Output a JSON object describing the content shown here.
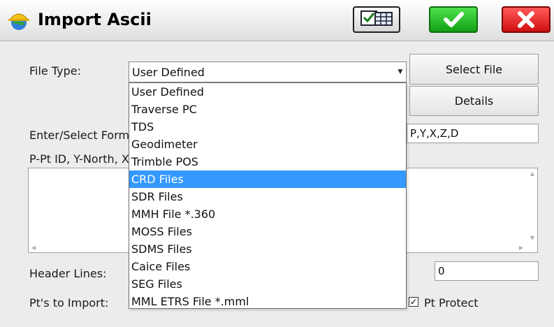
{
  "window": {
    "title": "Import Ascii",
    "icon": "hardhat-globe-icon",
    "buttons": [
      {
        "name": "view-table-button",
        "icon": "checklist-table-icon"
      },
      {
        "name": "ok-button",
        "icon": "checkmark-icon",
        "color": "#22c022"
      },
      {
        "name": "cancel-button",
        "icon": "close-x-icon",
        "color": "#e01818"
      }
    ]
  },
  "form": {
    "file_type_label": "File Type:",
    "file_type_value": "User Defined",
    "select_file_label": "Select File",
    "details_label": "Details",
    "format_label": "Enter/Select Format:",
    "format_value": "P,Y,X,Z,D",
    "legend_label": "P-Pt ID, Y-North, X-East, Z-Elev, D-Desc",
    "header_lines_label": "Header Lines:",
    "header_lines_value": "0",
    "pts_to_import_label": "Pt's to Import:",
    "pt_protect_label": "Pt Protect",
    "pt_protect_checked": true,
    "checkmark_glyph": "✓"
  },
  "dropdown": {
    "options": [
      "User Defined",
      "Traverse PC",
      "TDS",
      "Geodimeter",
      "Trimble POS",
      "CRD Files",
      "SDR Files",
      "MMH File *.360",
      "MOSS Files",
      "SDMS Files",
      "Caice Files",
      "SEG Files",
      "MML ETRS File *.mml"
    ],
    "highlighted": "CRD Files",
    "highlight_color": "#3399ff"
  },
  "scroll_glyphs": {
    "up": "▲",
    "down": "▼",
    "left": "◀",
    "right": "▶",
    "combo": "▼"
  }
}
